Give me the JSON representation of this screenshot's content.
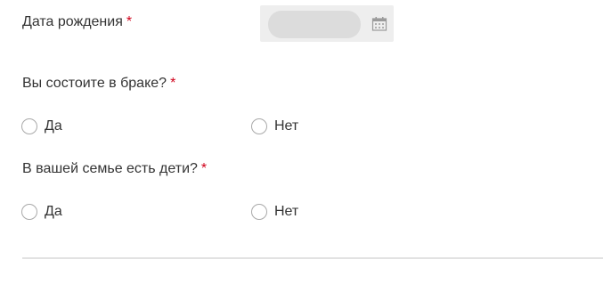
{
  "birth_date": {
    "label": "Дата рождения",
    "required_mark": "*",
    "value": "",
    "icon": "calendar-icon"
  },
  "married": {
    "label": "Вы состоите в браке?",
    "required_mark": "*",
    "options": [
      {
        "label": "Да",
        "selected": false
      },
      {
        "label": "Нет",
        "selected": false
      }
    ]
  },
  "children": {
    "label": "В вашей семье есть дети?",
    "required_mark": "*",
    "options": [
      {
        "label": "Да",
        "selected": false
      },
      {
        "label": "Нет",
        "selected": false
      }
    ]
  },
  "colors": {
    "required": "#d0021b",
    "text": "#333333",
    "radio_border": "#a9a9a9",
    "input_bg": "#dcdcdc",
    "input_wrap_bg": "#eeeeee",
    "divider": "#e2e2e2"
  }
}
